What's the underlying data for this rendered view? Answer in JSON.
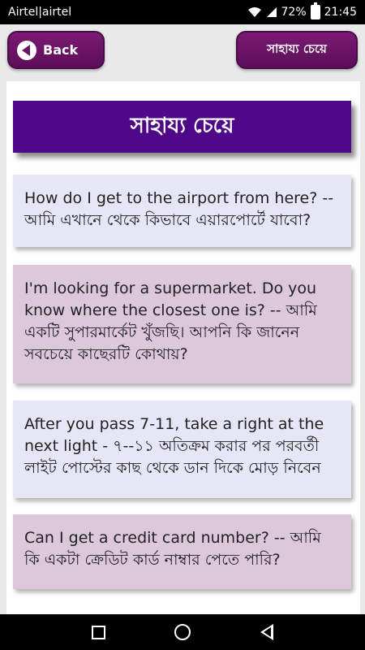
{
  "status_bar": {
    "carrier": "Airtel|airtel",
    "battery_percent": "72%",
    "time": "21:45"
  },
  "toolbar": {
    "back_label": "Back",
    "title_button_label": "সাহায্য চেয়ে"
  },
  "page": {
    "heading": "সাহায্য চেয়ে"
  },
  "cards": [
    {
      "text": "How do I get to the airport from here? -- আমি এখানে থেকে কিভাবে এয়ারপোর্টে যাবো?"
    },
    {
      "text": "I'm looking for a supermarket. Do you know where the closest one is? -- আমি একটি সুপারমার্কেট খুঁজছি। আপনি কি জানেন সবচেয়ে কাছেরটি কোথায়?"
    },
    {
      "text": "After you pass 7-11, take a right at the next light - ৭--১১ অতিক্রম করার পর পরবর্তী লাইট পোস্টের কাছ থেকে ডান দিকে মোড় নিবেন"
    },
    {
      "text": "Can I get a credit card number? -- আমি কি একটা ক্রেডিট কার্ড নাম্বার পেতে পারি?"
    }
  ],
  "icons": {
    "wifi": "wifi-icon",
    "signal": "signal-icon",
    "battery": "battery-icon",
    "back_arrow": "back-arrow-icon",
    "nav_recent": "square-icon",
    "nav_home": "circle-icon",
    "nav_back": "triangle-back-icon"
  },
  "colors": {
    "button": "#6a1465",
    "heading": "#4f0888",
    "card_lavender": "#e6e6f7",
    "card_pink": "#dcc7db"
  }
}
